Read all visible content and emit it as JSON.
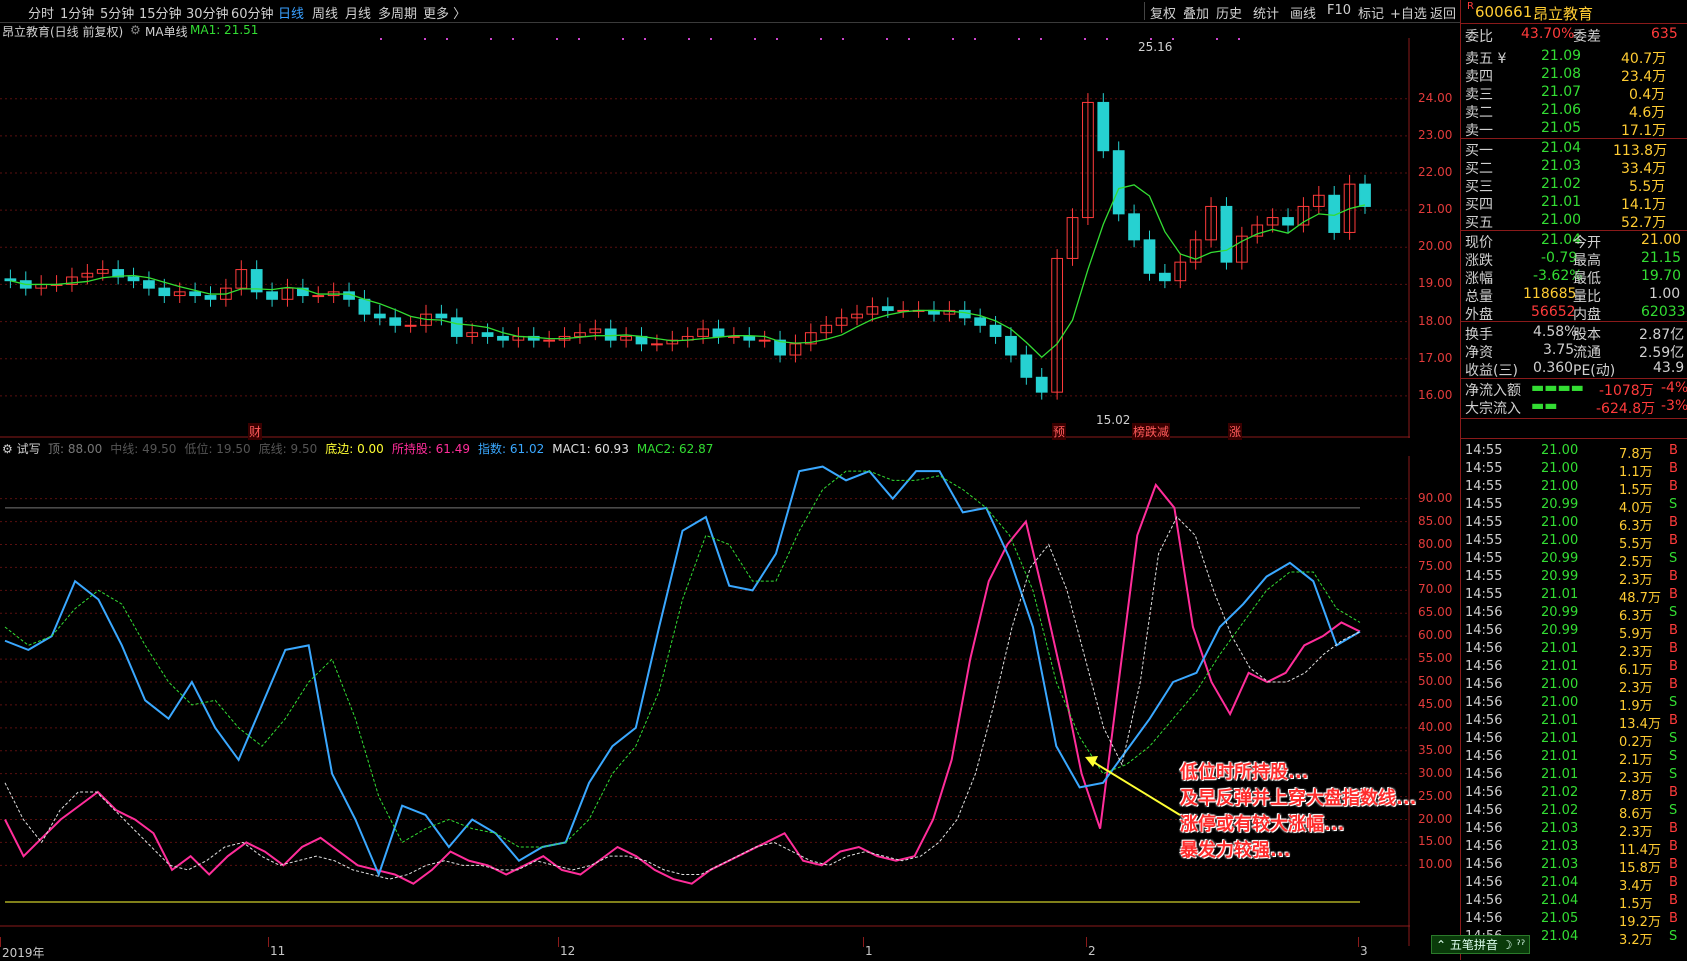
{
  "toolbar": {
    "left_items": [
      "分时",
      "1分钟",
      "5分钟",
      "15分钟",
      "30分钟",
      "60分钟",
      "日线",
      "周线",
      "月线",
      "多周期",
      "更多 〉"
    ],
    "active": "日线",
    "right_items": [
      "复权",
      "叠加",
      "历史",
      "统计",
      "画线",
      "F10",
      "标记",
      "+自选",
      "返回"
    ]
  },
  "main_chart": {
    "stock_title": "昂立教育(日线 前复权)",
    "indicator_name": "MA单线",
    "ma_label": "MA1: 21.51",
    "y_ticks": [
      "24.00",
      "23.00",
      "22.00",
      "21.00",
      "20.00",
      "19.00",
      "18.00",
      "17.00",
      "16.00"
    ],
    "high_label": "25.16",
    "low_label": "15.02",
    "events": [
      "财",
      "预",
      "榜跌减",
      "涨"
    ]
  },
  "sub_chart": {
    "name": "试写",
    "legend": [
      {
        "label": "顶: 88.00",
        "color": "#777777"
      },
      {
        "label": "中线: 49.50",
        "color": "#555555"
      },
      {
        "label": "低位: 19.50",
        "color": "#555555"
      },
      {
        "label": "底线: 9.50",
        "color": "#555555"
      },
      {
        "label": "底边: 0.00",
        "color": "#ffff33"
      },
      {
        "label": "所持股: 61.49",
        "color": "#ff2d9a"
      },
      {
        "label": "指数: 61.02",
        "color": "#3aa8ff"
      },
      {
        "label": "MAC1: 60.93",
        "color": "#e0e0e0"
      },
      {
        "label": "MAC2: 62.87",
        "color": "#33dd33"
      }
    ],
    "y_ticks": [
      "90.00",
      "85.00",
      "80.00",
      "75.00",
      "70.00",
      "65.00",
      "60.00",
      "55.00",
      "50.00",
      "45.00",
      "40.00",
      "35.00",
      "30.00",
      "25.00",
      "20.00",
      "15.00",
      "10.00"
    ]
  },
  "x_axis": [
    "2019年",
    "11",
    "12",
    "1",
    "2",
    "3"
  ],
  "annotation": [
    "低位时所持股...",
    "及早反弹并上穿大盘指数线...",
    "涨停或有较大涨幅...",
    "暴发力较强..."
  ],
  "chart_data": {
    "type": "line",
    "main_price_range": [
      15.0,
      25.5
    ],
    "candles_close": [
      19.1,
      18.9,
      19.0,
      19.0,
      19.2,
      19.3,
      19.4,
      19.2,
      19.1,
      18.9,
      18.7,
      18.8,
      18.7,
      18.6,
      18.9,
      19.4,
      18.8,
      18.6,
      18.9,
      18.7,
      18.7,
      18.8,
      18.6,
      18.2,
      18.1,
      17.9,
      17.9,
      18.2,
      18.1,
      17.6,
      17.7,
      17.6,
      17.5,
      17.6,
      17.5,
      17.5,
      17.6,
      17.7,
      17.8,
      17.5,
      17.6,
      17.4,
      17.4,
      17.5,
      17.6,
      17.8,
      17.6,
      17.6,
      17.5,
      17.5,
      17.1,
      17.4,
      17.7,
      17.9,
      18.1,
      18.2,
      18.4,
      18.3,
      18.3,
      18.3,
      18.2,
      18.3,
      18.1,
      17.9,
      17.6,
      17.1,
      16.5,
      16.1,
      19.7,
      20.8,
      23.9,
      22.6,
      20.9,
      20.2,
      19.3,
      19.1,
      19.6,
      20.2,
      21.1,
      19.6,
      20.3,
      20.6,
      20.8,
      20.6,
      21.1,
      21.4,
      20.4,
      21.7,
      21.1
    ],
    "series": [
      {
        "name": "所持股",
        "color": "#ff2d9a",
        "values": [
          20,
          12,
          16,
          20,
          23,
          26,
          22,
          20,
          17,
          9,
          12,
          8,
          12,
          15,
          13,
          10,
          14,
          16,
          13,
          10,
          9,
          8,
          6,
          9,
          13,
          11,
          10,
          8,
          10,
          12,
          9,
          8,
          11,
          14,
          12,
          9,
          7,
          6,
          9,
          11,
          13,
          15,
          17,
          11,
          10,
          13,
          14,
          12,
          11,
          12,
          20,
          33,
          55,
          72,
          80,
          85,
          68,
          50,
          30,
          18,
          50,
          82,
          93,
          88,
          62,
          50,
          43,
          52,
          50,
          52,
          58,
          60,
          63,
          61
        ]
      },
      {
        "name": "指数",
        "color": "#3aa8ff",
        "values": [
          59,
          57,
          60,
          72,
          68,
          58,
          46,
          42,
          50,
          40,
          33,
          45,
          57,
          58,
          30,
          20,
          8,
          23,
          21,
          14,
          20,
          17,
          11,
          14,
          15,
          28,
          36,
          40,
          62,
          83,
          86,
          71,
          70,
          78,
          96,
          97,
          94,
          96,
          90,
          96,
          96,
          87,
          88,
          77,
          62,
          36,
          27,
          28,
          35,
          42,
          50,
          52,
          62,
          67,
          73,
          76,
          72,
          58,
          61
        ]
      },
      {
        "name": "MAC1",
        "color": "#e0e0e0",
        "values": [
          28,
          20,
          15,
          22,
          26,
          26,
          22,
          18,
          14,
          10,
          9,
          11,
          14,
          15,
          12,
          10,
          11,
          12,
          11,
          9,
          8,
          7,
          8,
          10,
          11,
          10,
          10,
          9,
          9,
          11,
          10,
          9,
          10,
          12,
          12,
          11,
          9,
          8,
          8,
          10,
          12,
          14,
          15,
          13,
          11,
          10,
          12,
          13,
          12,
          11,
          12,
          15,
          20,
          30,
          45,
          62,
          75,
          80,
          70,
          55,
          40,
          32,
          50,
          78,
          86,
          82,
          70,
          60,
          53,
          50,
          50,
          52,
          56,
          59,
          61
        ]
      },
      {
        "name": "MAC2",
        "color": "#33dd33",
        "values": [
          62,
          58,
          60,
          66,
          70,
          67,
          58,
          50,
          45,
          46,
          40,
          36,
          42,
          50,
          55,
          42,
          25,
          15,
          18,
          20,
          18,
          17,
          14,
          14,
          15,
          20,
          30,
          36,
          48,
          68,
          82,
          80,
          72,
          72,
          83,
          92,
          96,
          96,
          94,
          94,
          95,
          92,
          88,
          82,
          70,
          50,
          38,
          30,
          32,
          36,
          42,
          48,
          56,
          63,
          70,
          74,
          74,
          66,
          63
        ]
      }
    ]
  }
}
